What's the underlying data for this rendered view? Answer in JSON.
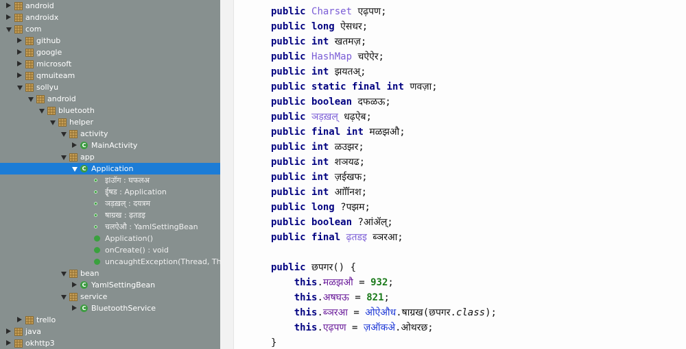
{
  "tree": [
    {
      "label": "android",
      "depth": 0,
      "arrow": "right",
      "icon": "package"
    },
    {
      "label": "androidx",
      "depth": 0,
      "arrow": "right",
      "icon": "package"
    },
    {
      "label": "com",
      "depth": 0,
      "arrow": "down",
      "icon": "package"
    },
    {
      "label": "github",
      "depth": 1,
      "arrow": "right",
      "icon": "package"
    },
    {
      "label": "google",
      "depth": 1,
      "arrow": "right",
      "icon": "package"
    },
    {
      "label": "microsoft",
      "depth": 1,
      "arrow": "right",
      "icon": "package"
    },
    {
      "label": "qmuiteam",
      "depth": 1,
      "arrow": "right",
      "icon": "package"
    },
    {
      "label": "sollyu",
      "depth": 1,
      "arrow": "down",
      "icon": "package"
    },
    {
      "label": "android",
      "depth": 2,
      "arrow": "down",
      "icon": "package"
    },
    {
      "label": "bluetooth",
      "depth": 3,
      "arrow": "down",
      "icon": "package"
    },
    {
      "label": "helper",
      "depth": 4,
      "arrow": "down",
      "icon": "package"
    },
    {
      "label": "activity",
      "depth": 5,
      "arrow": "down",
      "icon": "package"
    },
    {
      "label": "MainActivity",
      "depth": 6,
      "arrow": "right",
      "icon": "class"
    },
    {
      "label": "app",
      "depth": 5,
      "arrow": "down",
      "icon": "package"
    },
    {
      "label": "Application",
      "depth": 6,
      "arrow": "down",
      "icon": "class",
      "selected": true
    },
    {
      "label": "इlउॉग : घफलअ",
      "depth": 8,
      "arrow": "none",
      "icon": "field"
    },
    {
      "label": "ईृषड : Application",
      "depth": 8,
      "arrow": "none",
      "icon": "field-static"
    },
    {
      "label": "ञड़ख़ल् : दयत्रम",
      "depth": 8,
      "arrow": "none",
      "icon": "field"
    },
    {
      "label": "षाग्रख : ढ़तडइ",
      "depth": 8,
      "arrow": "none",
      "icon": "field-final"
    },
    {
      "label": "चलऐऔ : YamlSettingBean",
      "depth": 8,
      "arrow": "none",
      "icon": "field"
    },
    {
      "label": "Application()",
      "depth": 8,
      "arrow": "none",
      "icon": "method-ctor"
    },
    {
      "label": "onCreate() : void",
      "depth": 8,
      "arrow": "none",
      "icon": "method"
    },
    {
      "label": "uncaughtException(Thread, Throw",
      "depth": 8,
      "arrow": "none",
      "icon": "method"
    },
    {
      "label": "bean",
      "depth": 5,
      "arrow": "down",
      "icon": "package"
    },
    {
      "label": "YamlSettingBean",
      "depth": 6,
      "arrow": "right",
      "icon": "class"
    },
    {
      "label": "service",
      "depth": 5,
      "arrow": "down",
      "icon": "package"
    },
    {
      "label": "BluetoothService",
      "depth": 6,
      "arrow": "right",
      "icon": "class"
    },
    {
      "label": "trello",
      "depth": 1,
      "arrow": "right",
      "icon": "package"
    },
    {
      "label": "java",
      "depth": 0,
      "arrow": "right",
      "icon": "package"
    },
    {
      "label": "okhttp3",
      "depth": 0,
      "arrow": "right",
      "icon": "package"
    }
  ],
  "code": {
    "lines": [
      [
        {
          "t": "public",
          "c": "kw"
        },
        {
          "t": " "
        },
        {
          "t": "Charset",
          "c": "ty"
        },
        {
          "t": " एढ़पण;"
        }
      ],
      [
        {
          "t": "public",
          "c": "kw"
        },
        {
          "t": " "
        },
        {
          "t": "long",
          "c": "kw"
        },
        {
          "t": " ऐसधर;"
        }
      ],
      [
        {
          "t": "public",
          "c": "kw"
        },
        {
          "t": " "
        },
        {
          "t": "int",
          "c": "kw"
        },
        {
          "t": " खतमज़;"
        }
      ],
      [
        {
          "t": "public",
          "c": "kw"
        },
        {
          "t": " "
        },
        {
          "t": "HashMap",
          "c": "ty"
        },
        {
          "t": " चऐऐर;"
        }
      ],
      [
        {
          "t": "public",
          "c": "kw"
        },
        {
          "t": " "
        },
        {
          "t": "int",
          "c": "kw"
        },
        {
          "t": " झयतअ्;"
        }
      ],
      [
        {
          "t": "public",
          "c": "kw"
        },
        {
          "t": " "
        },
        {
          "t": "static",
          "c": "kw"
        },
        {
          "t": " "
        },
        {
          "t": "final",
          "c": "kw"
        },
        {
          "t": " "
        },
        {
          "t": "int",
          "c": "kw"
        },
        {
          "t": " णवज़ा;"
        }
      ],
      [
        {
          "t": "public",
          "c": "kw"
        },
        {
          "t": " "
        },
        {
          "t": "boolean",
          "c": "kw"
        },
        {
          "t": " दफळऊ;"
        }
      ],
      [
        {
          "t": "public",
          "c": "kw"
        },
        {
          "t": " "
        },
        {
          "t": "ञड़ख़ल्",
          "c": "ty"
        },
        {
          "t": " धढ़ऐब;"
        }
      ],
      [
        {
          "t": "public",
          "c": "kw"
        },
        {
          "t": " "
        },
        {
          "t": "final",
          "c": "kw"
        },
        {
          "t": " "
        },
        {
          "t": "int",
          "c": "kw"
        },
        {
          "t": " मळझऔ;"
        }
      ],
      [
        {
          "t": "public",
          "c": "kw"
        },
        {
          "t": " "
        },
        {
          "t": "int",
          "c": "kw"
        },
        {
          "t": " ळउझर;"
        }
      ],
      [
        {
          "t": "public",
          "c": "kw"
        },
        {
          "t": " "
        },
        {
          "t": "int",
          "c": "kw"
        },
        {
          "t": " शञयढ;"
        }
      ],
      [
        {
          "t": "public",
          "c": "kw"
        },
        {
          "t": " "
        },
        {
          "t": "int",
          "c": "kw"
        },
        {
          "t": " ज़ईखफ;"
        }
      ],
      [
        {
          "t": "public",
          "c": "kw"
        },
        {
          "t": " "
        },
        {
          "t": "int",
          "c": "kw"
        },
        {
          "t": " आॉॉनश;"
        }
      ],
      [
        {
          "t": "public",
          "c": "kw"
        },
        {
          "t": " "
        },
        {
          "t": "long",
          "c": "kw"
        },
        {
          "t": " ?पझम;"
        }
      ],
      [
        {
          "t": "public",
          "c": "kw"
        },
        {
          "t": " "
        },
        {
          "t": "boolean",
          "c": "kw"
        },
        {
          "t": " ?आंॲल्;"
        }
      ],
      [
        {
          "t": "public",
          "c": "kw"
        },
        {
          "t": " "
        },
        {
          "t": "final",
          "c": "kw"
        },
        {
          "t": " "
        },
        {
          "t": "ढ़तडइ",
          "c": "ty"
        },
        {
          "t": " ब्ञरआ;"
        }
      ],
      [],
      [
        {
          "t": "public",
          "c": "kw"
        },
        {
          "t": " छपगर() {"
        }
      ],
      [
        {
          "t": "    "
        },
        {
          "t": "this",
          "c": "kw"
        },
        {
          "t": "."
        },
        {
          "t": "मळझऔ",
          "c": "fldc"
        },
        {
          "t": " = "
        },
        {
          "t": "932",
          "c": "num"
        },
        {
          "t": ";"
        }
      ],
      [
        {
          "t": "    "
        },
        {
          "t": "this",
          "c": "kw"
        },
        {
          "t": "."
        },
        {
          "t": "अषघऊ",
          "c": "fldc"
        },
        {
          "t": " = "
        },
        {
          "t": "821",
          "c": "num"
        },
        {
          "t": ";"
        }
      ],
      [
        {
          "t": "    "
        },
        {
          "t": "this",
          "c": "kw"
        },
        {
          "t": "."
        },
        {
          "t": "ब्ञरआ",
          "c": "fldc"
        },
        {
          "t": " = "
        },
        {
          "t": "ओऐऔध",
          "c": "blu"
        },
        {
          "t": ".षाग्रख(छपगर."
        },
        {
          "t": "class",
          "c": "it"
        },
        {
          "t": ");"
        }
      ],
      [
        {
          "t": "    "
        },
        {
          "t": "this",
          "c": "kw"
        },
        {
          "t": "."
        },
        {
          "t": "एढ़पण",
          "c": "fldc"
        },
        {
          "t": " = "
        },
        {
          "t": "ज़ऑकअे",
          "c": "blu"
        },
        {
          "t": ".ओथरछ;"
        }
      ],
      [
        {
          "t": "}"
        }
      ]
    ]
  }
}
